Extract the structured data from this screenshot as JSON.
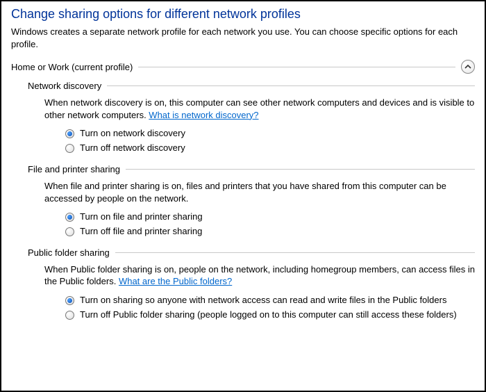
{
  "title": "Change sharing options for different network profiles",
  "subtitle": "Windows creates a separate network profile for each network you use. You can choose specific options for each profile.",
  "profile": {
    "label": "Home or Work (current profile)"
  },
  "sections": {
    "discovery": {
      "heading": "Network discovery",
      "desc_before": "When network discovery is on, this computer can see other network computers and devices and is visible to other network computers. ",
      "link": "What is network discovery?",
      "opt_on": "Turn on network discovery",
      "opt_off": "Turn off network discovery",
      "selected": "on"
    },
    "file_printer": {
      "heading": "File and printer sharing",
      "desc": "When file and printer sharing is on, files and printers that you have shared from this computer can be accessed by people on the network.",
      "opt_on": "Turn on file and printer sharing",
      "opt_off": "Turn off file and printer sharing",
      "selected": "on"
    },
    "public_folder": {
      "heading": "Public folder sharing",
      "desc_before": "When Public folder sharing is on, people on the network, including homegroup members, can access files in the Public folders. ",
      "link": "What are the Public folders?",
      "opt_on": "Turn on sharing so anyone with network access can read and write files in the Public folders",
      "opt_off": "Turn off Public folder sharing (people logged on to this computer can still access these folders)",
      "selected": "on"
    }
  }
}
